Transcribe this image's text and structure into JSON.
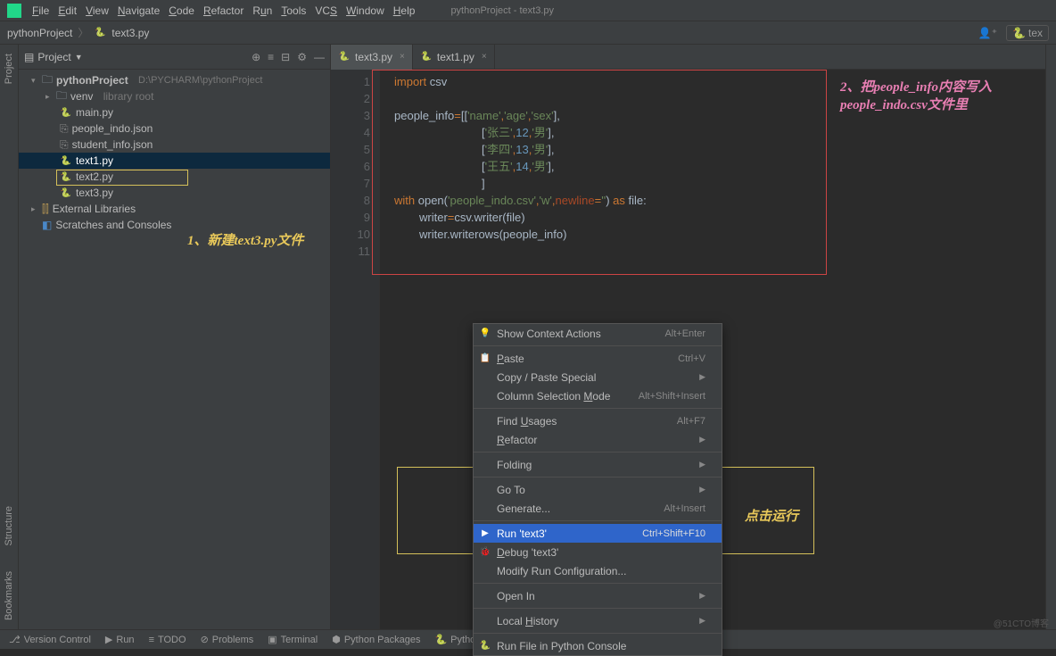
{
  "title": "pythonProject - text3.py",
  "menu": [
    "File",
    "Edit",
    "View",
    "Navigate",
    "Code",
    "Refactor",
    "Run",
    "Tools",
    "VCS",
    "Window",
    "Help"
  ],
  "breadcrumb": {
    "project": "pythonProject",
    "file": "text3.py"
  },
  "navbar_right": {
    "label": "tex"
  },
  "sidebar": {
    "title": "Project",
    "root": {
      "name": "pythonProject",
      "path": "D:\\PYCHARM\\pythonProject"
    },
    "venv": {
      "name": "venv",
      "hint": "library root"
    },
    "files": [
      "main.py",
      "people_indo.json",
      "student_info.json",
      "text1.py",
      "text2.py",
      "text3.py"
    ],
    "ext_lib": "External Libraries",
    "scratch": "Scratches and Consoles"
  },
  "tabs": [
    {
      "name": "text3.py",
      "active": true
    },
    {
      "name": "text1.py",
      "active": false
    }
  ],
  "code": {
    "lines": [
      "1",
      "2",
      "3",
      "4",
      "5",
      "6",
      "7",
      "8",
      "9",
      "10",
      "11"
    ],
    "l1a": "import",
    "l1b": " csv",
    "l3a": "people_info",
    "l3b": "=",
    "l3c": "[[",
    "l3d": "'name'",
    "l3e": ",",
    "l3f": "'age'",
    "l3g": ",",
    "l3h": "'sex'",
    "l3i": "],",
    "l4a": "[",
    "l4b": "'张三'",
    "l4c": ",",
    "l4d": "12",
    "l4e": ",",
    "l4f": "'男'",
    "l4g": "],",
    "l5a": "[",
    "l5b": "'李四'",
    "l5c": ",",
    "l5d": "13",
    "l5e": ",",
    "l5f": "'男'",
    "l5g": "],",
    "l6a": "[",
    "l6b": "'王五'",
    "l6c": ",",
    "l6d": "14",
    "l6e": ",",
    "l6f": "'男'",
    "l6g": "],",
    "l7a": "]",
    "l8a": "with",
    "l8b": " open(",
    "l8c": "'people_indo.csv'",
    "l8d": ",",
    "l8e": "'w'",
    "l8f": ",",
    "l8g": "newline",
    "l8h": "=",
    "l8i": "''",
    "l8j": ") ",
    "l8k": "as",
    "l8l": " file:",
    "l9a": "writer",
    "l9b": "=",
    "l9c": "csv.writer(file)",
    "l10": "writer.writerows(people_info)"
  },
  "context_menu": [
    {
      "label": "Show Context Actions",
      "shortcut": "Alt+Enter",
      "icon": "💡"
    },
    {
      "sep": true
    },
    {
      "label": "Paste",
      "shortcut": "Ctrl+V",
      "icon": "📋",
      "u": "P"
    },
    {
      "label": "Copy / Paste Special",
      "sub": true
    },
    {
      "label": "Column Selection Mode",
      "shortcut": "Alt+Shift+Insert",
      "u": "M"
    },
    {
      "sep": true
    },
    {
      "label": "Find Usages",
      "shortcut": "Alt+F7",
      "u": "U"
    },
    {
      "label": "Refactor",
      "sub": true,
      "u": "R"
    },
    {
      "sep": true
    },
    {
      "label": "Folding",
      "sub": true
    },
    {
      "sep": true
    },
    {
      "label": "Go To",
      "sub": true
    },
    {
      "label": "Generate...",
      "shortcut": "Alt+Insert"
    },
    {
      "sep": true
    },
    {
      "label": "Run 'text3'",
      "shortcut": "Ctrl+Shift+F10",
      "icon": "▶",
      "sel": true
    },
    {
      "label": "Debug 'text3'",
      "icon": "🐞",
      "u": "D"
    },
    {
      "label": "Modify Run Configuration..."
    },
    {
      "sep": true
    },
    {
      "label": "Open In",
      "sub": true
    },
    {
      "sep": true
    },
    {
      "label": "Local History",
      "sub": true,
      "u": "H"
    },
    {
      "sep": true
    },
    {
      "label": "Run File in Python Console",
      "icon": "🐍"
    }
  ],
  "annotation1": "1、新建text3.py文件",
  "annotation2a": "2、把people_info内容写入",
  "annotation2b": "people_indo.csv文件里",
  "annotation3": "点击运行",
  "statusbar": {
    "vc": "Version Control",
    "run": "Run",
    "todo": "TODO",
    "prob": "Problems",
    "term": "Terminal",
    "pkg": "Python Packages",
    "pycon": "Python Console"
  },
  "left_tabs": {
    "top": "Project",
    "mid": "Structure",
    "bot": "Bookmarks"
  },
  "watermark": "@51CTO博客"
}
